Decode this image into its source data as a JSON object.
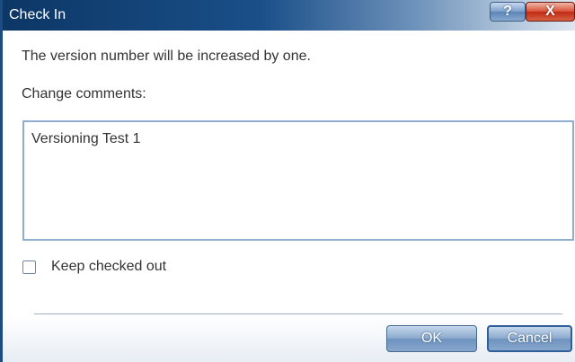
{
  "window": {
    "title": "Check In",
    "help_label": "?",
    "close_label": "X"
  },
  "content": {
    "message": "The version number will be increased by one.",
    "comments_label": "Change comments:",
    "comments_value": "Versioning Test 1",
    "keep_checked_out_label": "Keep checked out",
    "keep_checked_out_checked": false
  },
  "buttons": {
    "ok": "OK",
    "cancel": "Cancel"
  },
  "colors": {
    "titlebar": "#1a4f88",
    "close_button": "#c02a12",
    "button": "#6e93c0"
  }
}
